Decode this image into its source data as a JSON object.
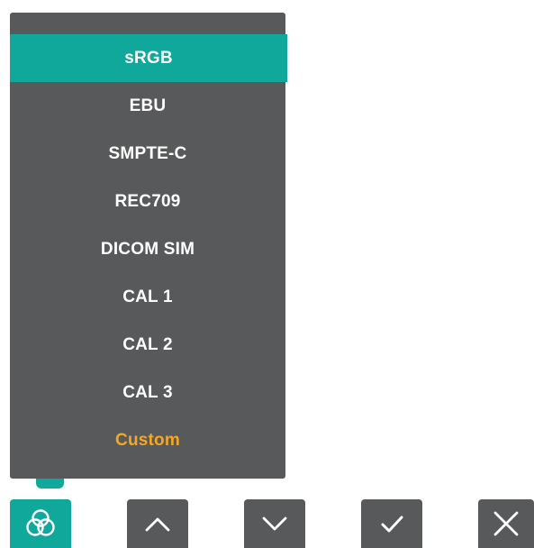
{
  "menu": {
    "items": [
      {
        "label": "sRGB",
        "selected": true
      },
      {
        "label": "EBU"
      },
      {
        "label": "SMPTE-C"
      },
      {
        "label": "REC709"
      },
      {
        "label": "DICOM SIM"
      },
      {
        "label": "CAL 1"
      },
      {
        "label": "CAL 2"
      },
      {
        "label": "CAL 3"
      },
      {
        "label": "Custom",
        "highlight": true
      }
    ]
  },
  "toolbar": {
    "buttons": [
      {
        "icon": "color-mode-icon",
        "active": true
      },
      {
        "icon": "chevron-up-icon"
      },
      {
        "icon": "chevron-down-icon"
      },
      {
        "icon": "checkmark-icon"
      },
      {
        "icon": "close-icon"
      }
    ]
  },
  "colors": {
    "panel": "#58595b",
    "accent": "#0fa89b",
    "custom_text": "#f5a623",
    "text": "#ffffff"
  }
}
